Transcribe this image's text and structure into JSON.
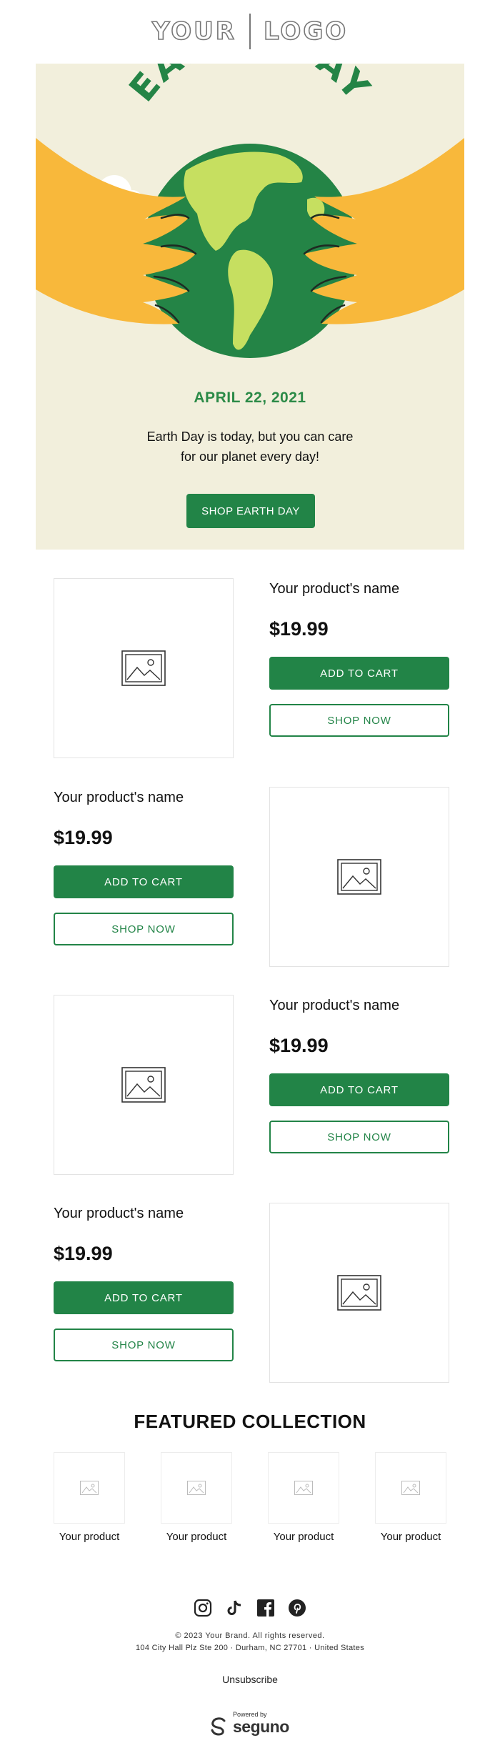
{
  "header": {
    "logo_left": "YOUR",
    "logo_right": "LOGO"
  },
  "hero": {
    "headline": "EARTH DAY",
    "date": "APRIL 22, 2021",
    "tagline": "Earth Day is today, but you can care for our planet every day!",
    "button": "SHOP EARTH DAY",
    "colors": {
      "background": "#f2efdc",
      "accent_green": "#228447",
      "hands": "#f8b83b"
    }
  },
  "products": [
    {
      "name": "Your product's name",
      "price": "$19.99",
      "add_to_cart": "ADD TO CART",
      "shop_now": "SHOP NOW",
      "image_icon": "image-placeholder-icon"
    },
    {
      "name": "Your product's name",
      "price": "$19.99",
      "add_to_cart": "ADD TO CART",
      "shop_now": "SHOP NOW",
      "image_icon": "image-placeholder-icon"
    },
    {
      "name": "Your product's name",
      "price": "$19.99",
      "add_to_cart": "ADD TO CART",
      "shop_now": "SHOP NOW",
      "image_icon": "image-placeholder-icon"
    },
    {
      "name": "Your product's name",
      "price": "$19.99",
      "add_to_cart": "ADD TO CART",
      "shop_now": "SHOP NOW",
      "image_icon": "image-placeholder-icon"
    }
  ],
  "featured": {
    "title": "FEATURED COLLECTION",
    "items": [
      {
        "label": "Your product"
      },
      {
        "label": "Your product"
      },
      {
        "label": "Your product"
      },
      {
        "label": "Your product"
      }
    ]
  },
  "footer": {
    "social_icons": [
      "instagram-icon",
      "tiktok-icon",
      "facebook-icon",
      "pinterest-icon"
    ],
    "copyright": "© 2023 Your Brand. All rights reserved.",
    "address": "104 City Hall Plz Ste 200 · Durham, NC 27701 · United States",
    "unsubscribe": "Unsubscribe",
    "powered_by": "Powered by",
    "powered_brand": "seguno"
  }
}
